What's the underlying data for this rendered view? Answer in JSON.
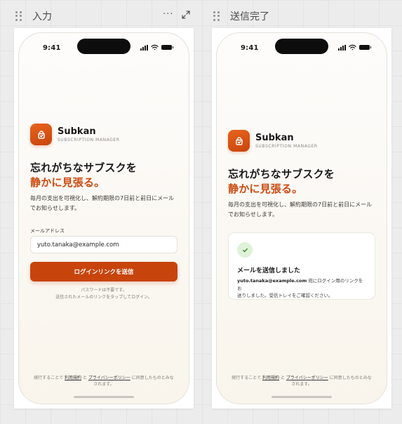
{
  "artboards": [
    {
      "title": "入力",
      "tools": {
        "more_glyph": "···"
      }
    },
    {
      "title": "送信完了"
    }
  ],
  "status_bar": {
    "time": "9:41"
  },
  "brand": {
    "name": "Subkan",
    "subtitle": "SUBSCRIPTION MANAGER"
  },
  "headline": {
    "line1": "忘れがちなサブスクを",
    "line2": "静かに見張る。"
  },
  "description": "毎月の支出を可視化し、解約期限の7日前と前日にメールでお知らせします。",
  "form": {
    "email_label": "メールアドレス",
    "email_value": "yuto.tanaka@example.com",
    "submit_label": "ログインリンクを送信",
    "note_line1": "パスワードは不要です。",
    "note_line2": "送信されたメールのリンクをタップしてログイン。"
  },
  "terms": {
    "prefix": "続行することで",
    "terms_link": "利用規約",
    "and": "と",
    "privacy_link": "プライバシーポリシー",
    "suffix_line1": "に同意したものとみな",
    "suffix_line2": "されます。"
  },
  "success": {
    "title": "メールを送信しました",
    "email": "yuto.tanaka@example.com",
    "body_suffix": " 宛にログイン用のリンクをお",
    "body_line2": "送りしました。受信トレイをご確認ください。"
  },
  "colors": {
    "accent": "#c8440d",
    "success_bg": "#dff2d9",
    "success_check": "#3a8a2e"
  },
  "icons": [
    "drag-handle-icon",
    "more-icon",
    "expand-icon",
    "signal-icon",
    "wifi-icon",
    "battery-icon",
    "app-logo-icon",
    "checkmark-icon"
  ]
}
